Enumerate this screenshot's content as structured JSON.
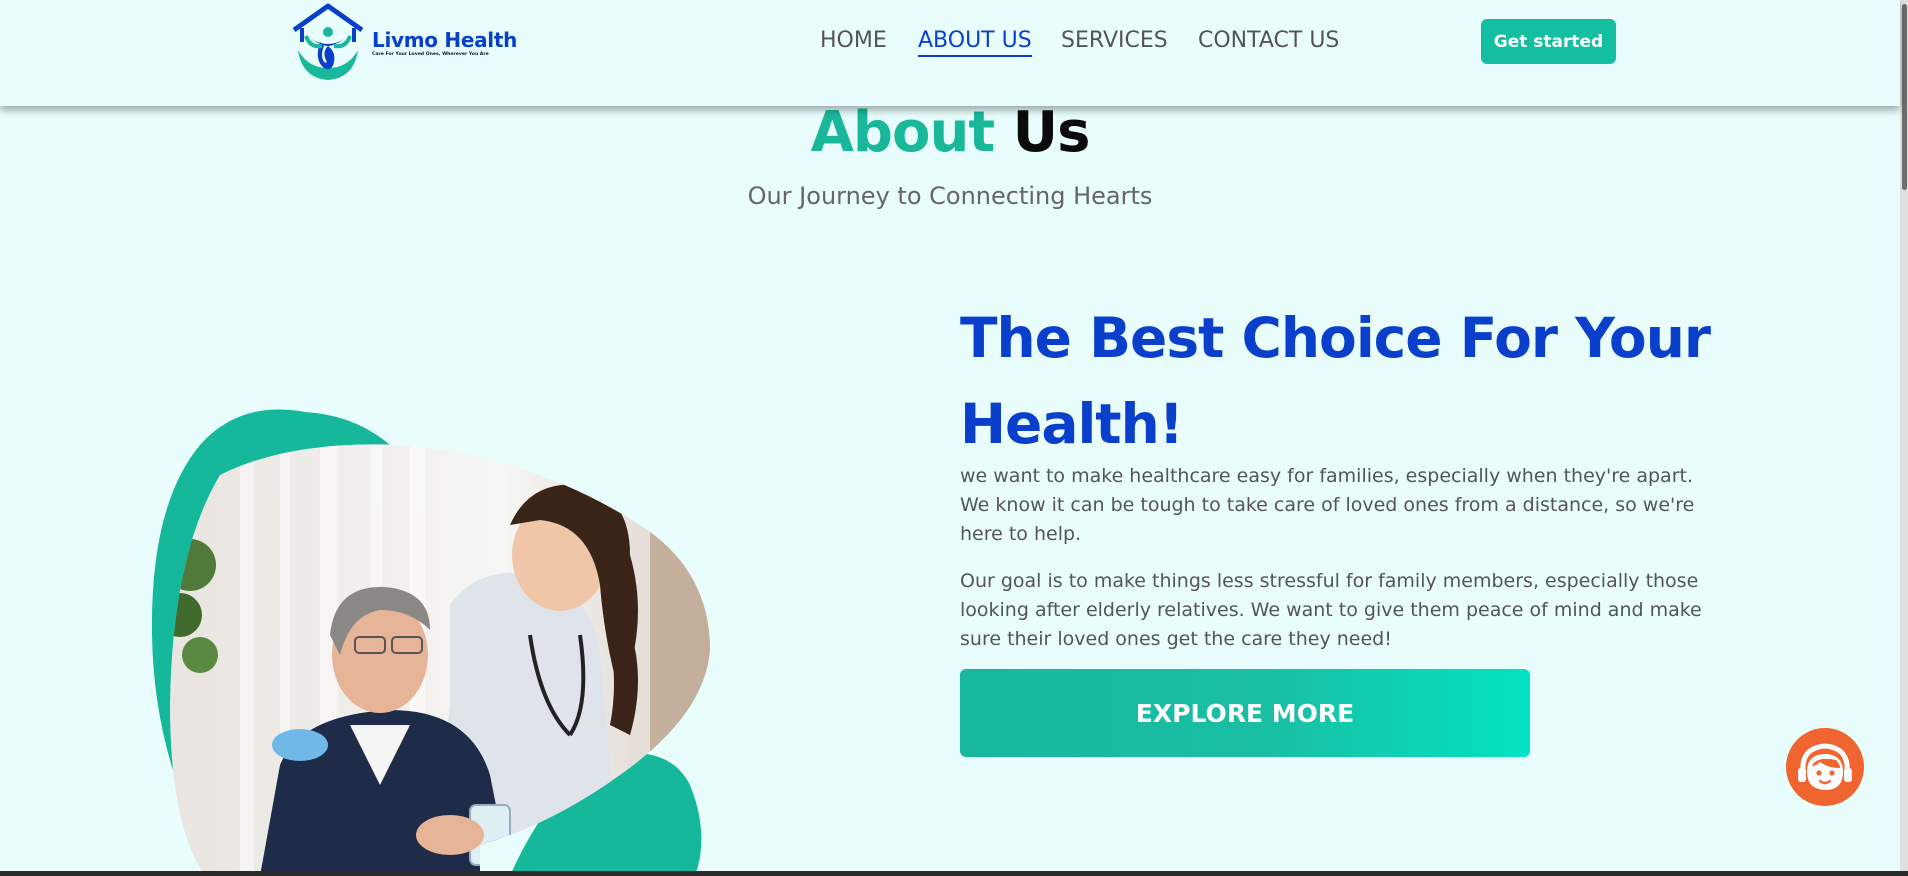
{
  "brand": {
    "name": "Livmo Health",
    "tagline": "Care For Your Loved Ones, Wherever You Are",
    "logo_icon": "house-with-person-logo"
  },
  "nav": {
    "items": [
      {
        "label": "HOME",
        "active": false
      },
      {
        "label": "ABOUT US",
        "active": true
      },
      {
        "label": "SERVICES",
        "active": false
      },
      {
        "label": "CONTACT US",
        "active": false
      }
    ],
    "cta_label": "Get started"
  },
  "about": {
    "title_part1": "About",
    "title_part2": "Us",
    "subtitle": "Our Journey to Connecting Hearts"
  },
  "hero": {
    "headline": "The Best Choice For Your Health!",
    "paragraph1": "we want to make healthcare easy for families, especially when they're apart. We know it can be tough to take care of loved ones from a distance, so we're here to help.",
    "paragraph2": "Our goal is to make things less stressful for family members, especially those looking after elderly relatives. We want to give them peace of mind and make sure their loved ones get the care they need!",
    "button_label": "EXPLORE MORE",
    "image_subject": "nurse-with-elderly-man-photo"
  },
  "chat": {
    "icon": "support-agent-icon"
  },
  "colors": {
    "background": "#e9fefc",
    "primary_blue": "#0a3fcc",
    "teal": "#14bfa1",
    "chat_orange": "#f06430"
  }
}
